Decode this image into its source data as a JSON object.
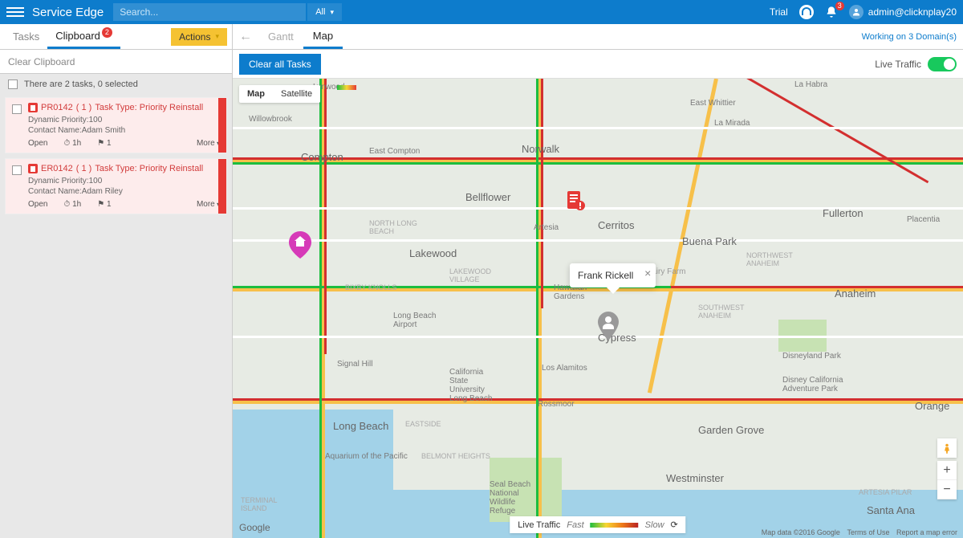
{
  "header": {
    "app_title": "Service Edge",
    "search_placeholder": "Search...",
    "filter_label": "All",
    "trial_label": "Trial",
    "notif_count": "3",
    "user_label": "admin@clicknplay20"
  },
  "left": {
    "tab_tasks": "Tasks",
    "tab_clipboard": "Clipboard",
    "clipboard_badge": "2",
    "actions_label": "Actions",
    "clear_label": "Clear Clipboard",
    "count_text": "There are 2 tasks, 0 selected",
    "tasks": [
      {
        "id": "PR0142",
        "count": "( 1 )",
        "type_label": "Task Type: Priority Reinstall",
        "priority": "Dynamic Priority:100",
        "contact": "Contact Name:Adam Smith",
        "status": "Open",
        "duration": "1h",
        "flag": "1",
        "more": "More"
      },
      {
        "id": "ER0142",
        "count": "( 1 )",
        "type_label": "Task Type: Priority Reinstall",
        "priority": "Dynamic Priority:100",
        "contact": "Contact Name:Adam Riley",
        "status": "Open",
        "duration": "1h",
        "flag": "1",
        "more": "More"
      }
    ]
  },
  "right": {
    "gantt_label": "Gantt",
    "map_label": "Map",
    "domains_text": "Working on 3 Domain(s)",
    "clear_all": "Clear all Tasks",
    "live_traffic_lbl": "Live Traffic",
    "map_type_map": "Map",
    "map_type_sat": "Satellite",
    "info_name": "Frank Rickell",
    "legend_live": "Live Traffic",
    "legend_fast": "Fast",
    "legend_slow": "Slow",
    "google": "Google",
    "attribution": "Map data ©2016 Google",
    "terms": "Terms of Use",
    "report": "Report a map error"
  },
  "cities": {
    "lynwood": "Lynwood",
    "willowbrook": "Willowbrook",
    "compton": "Compton",
    "ecompton": "East Compton",
    "norwalk": "Norwalk",
    "lamirada": "La Mirada",
    "ewhittier": "East Whittier",
    "lahabra": "La Habra",
    "bellflower": "Bellflower",
    "artesia": "Artesia",
    "cerritos": "Cerritos",
    "buenapark": "Buena Park",
    "fullerton": "Fullerton",
    "placentia": "Placentia",
    "anaheim": "Anaheim",
    "cypress": "Cypress",
    "lakewood": "Lakewood",
    "hawaiiang": "Hawaiian\nGardens",
    "longbeacha": "Long Beach\nAirport",
    "losalamitos": "Los Alamitos",
    "signalhill": "Signal Hill",
    "csulb": "California\nState\nUniversity\nLong Beach",
    "rossmoor": "Rossmoor",
    "gardengrove": "Garden Grove",
    "disneyland": "Disneyland Park",
    "dca": "Disney California\nAdventure Park",
    "orange": "Orange",
    "longbeach": "Long Beach",
    "aquarium": "Aquarium of the Pacific",
    "westminster": "Westminster",
    "santaana": "Santa Ana",
    "sealbeach": "Seal Beach\nNational\nWildlife\nRefuge",
    "lakewoodv": "LAKEWOOD\nVILLAGE",
    "nlongbeach": "NORTH LONG\nBEACH",
    "bixby": "BIXBY KNOLLS",
    "belmont": "BELMONT HEIGHTS",
    "eastside": "EASTSIDE",
    "terminal": "TERMINAL\nISLAND",
    "dairyfarm": "Dairy Farm",
    "swanaheim": "SOUTHWEST\nANAHEIM",
    "northwest": "NORTHWEST\nANAHEIM",
    "artesiap": "ARTESIA PILAR"
  }
}
